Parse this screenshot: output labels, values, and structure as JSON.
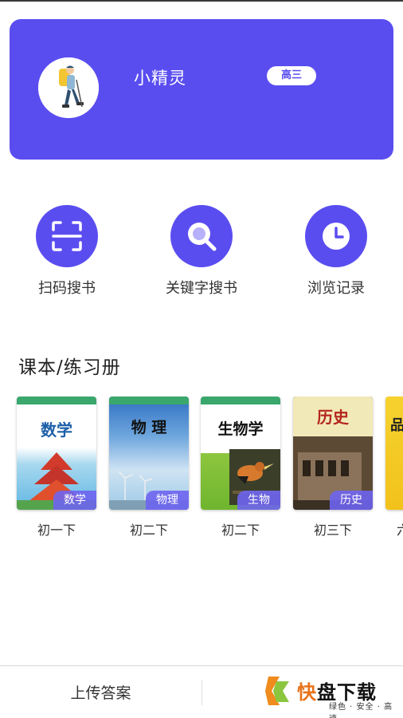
{
  "profile": {
    "username": "小精灵",
    "grade": "高三"
  },
  "actions": [
    {
      "label": "扫码搜书",
      "icon": "scan-icon"
    },
    {
      "label": "关键字搜书",
      "icon": "search-icon"
    },
    {
      "label": "浏览记录",
      "icon": "clock-icon"
    }
  ],
  "section": {
    "title": "课本/练习册"
  },
  "books": [
    {
      "cover_title": "数学",
      "subject": "数学",
      "grade": "初一下"
    },
    {
      "cover_title": "物 理",
      "subject": "物理",
      "grade": "初二下"
    },
    {
      "cover_title": "生物学",
      "subject": "生物",
      "grade": "初二下"
    },
    {
      "cover_title": "历史",
      "subject": "历史",
      "grade": "初三下"
    },
    {
      "cover_title": "品",
      "subject": "",
      "grade": "六"
    }
  ],
  "bottom": {
    "upload_label": "上传答案"
  },
  "watermark": {
    "brand_a": "快",
    "brand_b": "盘下载",
    "tagline": "绿色 · 安全 · 高速"
  },
  "colors": {
    "accent": "#5a4df0",
    "card_text": "#ffffff"
  }
}
